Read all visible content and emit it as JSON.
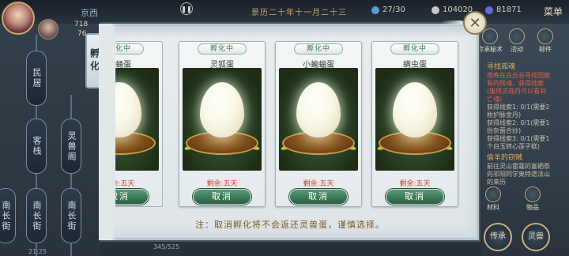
{
  "top_bar": {
    "location": "京西",
    "date": "景历二十年十一月二十三",
    "player_stat_1": "718",
    "player_stat_2": "76",
    "energy": "27/30",
    "silver": "104020",
    "gold": "81871",
    "menu_label": "菜单"
  },
  "left_nav": {
    "items": [
      "民居",
      "客栈",
      "灵兽阁",
      "南长街",
      "南长街",
      "南长街"
    ]
  },
  "side_tab": {
    "label": "孵化"
  },
  "panel": {
    "notice": "注：取消孵化将不会返还灵兽蛋，谨慎选择。",
    "close_icon": "✕"
  },
  "eggs": [
    {
      "status": "孵化中",
      "name": "穿蛹蛋",
      "remaining": "剩余:五天",
      "cancel": "取消"
    },
    {
      "status": "孵化中",
      "name": "灵狐蛋",
      "remaining": "剩余:五天",
      "cancel": "取消"
    },
    {
      "status": "孵化中",
      "name": "小蝙蝠蛋",
      "remaining": "剩余:五天",
      "cancel": "取消"
    },
    {
      "status": "孵化中",
      "name": "螨虫蛋",
      "remaining": "剩余:五天",
      "cancel": "取消"
    }
  ],
  "right_panel": {
    "icons": [
      "传承秘术",
      "活动",
      "邮件"
    ],
    "quest_title": "寻找孤魂",
    "quest_lines": [
      "夜晚在白云谷寻找园宸",
      "有的残魂，获得线索",
      "(服用灵视丹可以看到",
      "亡魂)",
      "获得线索1: 0/1(需要2",
      "枚护脉金丹)",
      "获得线索2: 0/1(需要1",
      "份杂菌合炒)",
      "获得线索3: 0/1(需要1",
      "个白玉转心莲子糕)"
    ],
    "quest2_title": "偷羊的窃贼",
    "quest2_lines": [
      "前往灵山雷霆的富硒祭",
      "向祁阳同学奥特遗法山",
      "的来历"
    ],
    "bottom_icons": [
      "材料",
      "物品"
    ],
    "big_icons": [
      "传承",
      "灵兽"
    ]
  },
  "bottom_bar": {
    "time": "21:25",
    "capacity": "345/525"
  },
  "colors": {
    "status_green": "#2f7a52",
    "remaining_red": "#d03a2a",
    "cancel_button": "#3c7a5a",
    "panel_bg": "#e9edee"
  }
}
